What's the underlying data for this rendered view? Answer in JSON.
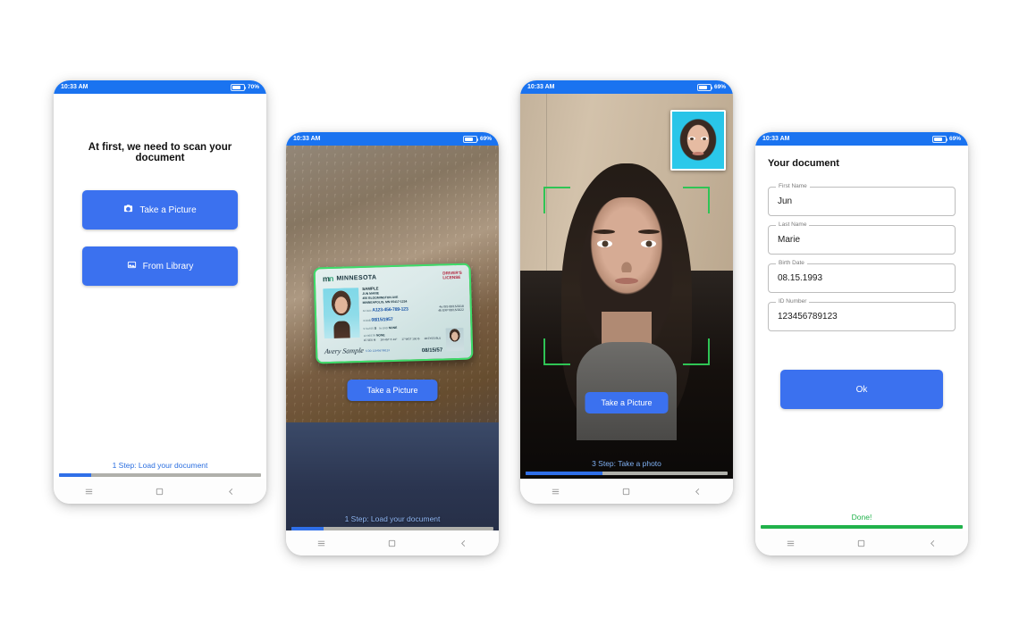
{
  "phones": [
    {
      "id": "load-document",
      "status": {
        "time": "10:33 AM",
        "battery": "70%"
      },
      "title": "At first, we need to scan your document",
      "buttons": {
        "camera": "Take a Picture",
        "library": "From Library"
      },
      "footer": {
        "step": "1 Step: Load your document",
        "progress": 16
      }
    },
    {
      "id": "scan-document",
      "status": {
        "time": "10:33 AM",
        "battery": "69%"
      },
      "button": "Take a Picture",
      "footer": {
        "step": "1 Step: Load your document",
        "progress": 16
      },
      "license": {
        "state": "MINNESOTA",
        "type_line1": "DRIVER'S",
        "type_line2": "LICENSE",
        "name_line1": "SAMPLE",
        "name_line2": "JUN MARIE",
        "address_line1": "456 BLOOMINGTON AVE",
        "address_line2": "MINNEAPOLIS, MN 55417-1234",
        "dln_label": "4d DLN",
        "dln": "A123-456-789-123",
        "iss_label": "4a ISS",
        "iss": "08/15/2018",
        "dob_label": "3 DOB",
        "dob": "08/15/1957",
        "exp_label": "4b EXP",
        "exp": "08/15/2022",
        "class_label": "9 CLASS",
        "class": "D",
        "end_label": "9a END",
        "end": "NONE",
        "restr_label": "12 RESTR",
        "restr": "NONE",
        "sex_label": "15 SEX",
        "sex": "M",
        "hgt_label": "16 HGT",
        "hgt": "5'-10\"",
        "wgt_label": "17 WGT",
        "wgt": "150 lb",
        "eyes_label": "18 EYES",
        "eyes": "BLU",
        "dd_label": "5 DD",
        "dd": "123456789123",
        "signature": "Avery Sample",
        "issue_date": "08/15/57"
      }
    },
    {
      "id": "take-photo",
      "status": {
        "time": "10:33 AM",
        "battery": "69%"
      },
      "button": "Take a Picture",
      "footer": {
        "step": "3 Step: Take a photo",
        "progress": 38
      }
    },
    {
      "id": "your-document",
      "status": {
        "time": "10:33 AM",
        "battery": "69%"
      },
      "title": "Your document",
      "fields": [
        {
          "label": "First Name",
          "value": "Jun"
        },
        {
          "label": "Last Name",
          "value": "Marie"
        },
        {
          "label": "Birth Date",
          "value": "08.15.1993"
        },
        {
          "label": "ID Number",
          "value": "123456789123"
        }
      ],
      "ok_button": "Ok",
      "footer": {
        "step": "Done!",
        "progress": 100
      }
    }
  ],
  "nav": {
    "menu": "menu-icon",
    "home": "home-square-icon",
    "back": "back-chevron-icon"
  },
  "colors": {
    "accent": "#3b71ef",
    "status_bar": "#1a73f0",
    "progress_done": "#21b24b",
    "bracket": "#2fc455"
  }
}
